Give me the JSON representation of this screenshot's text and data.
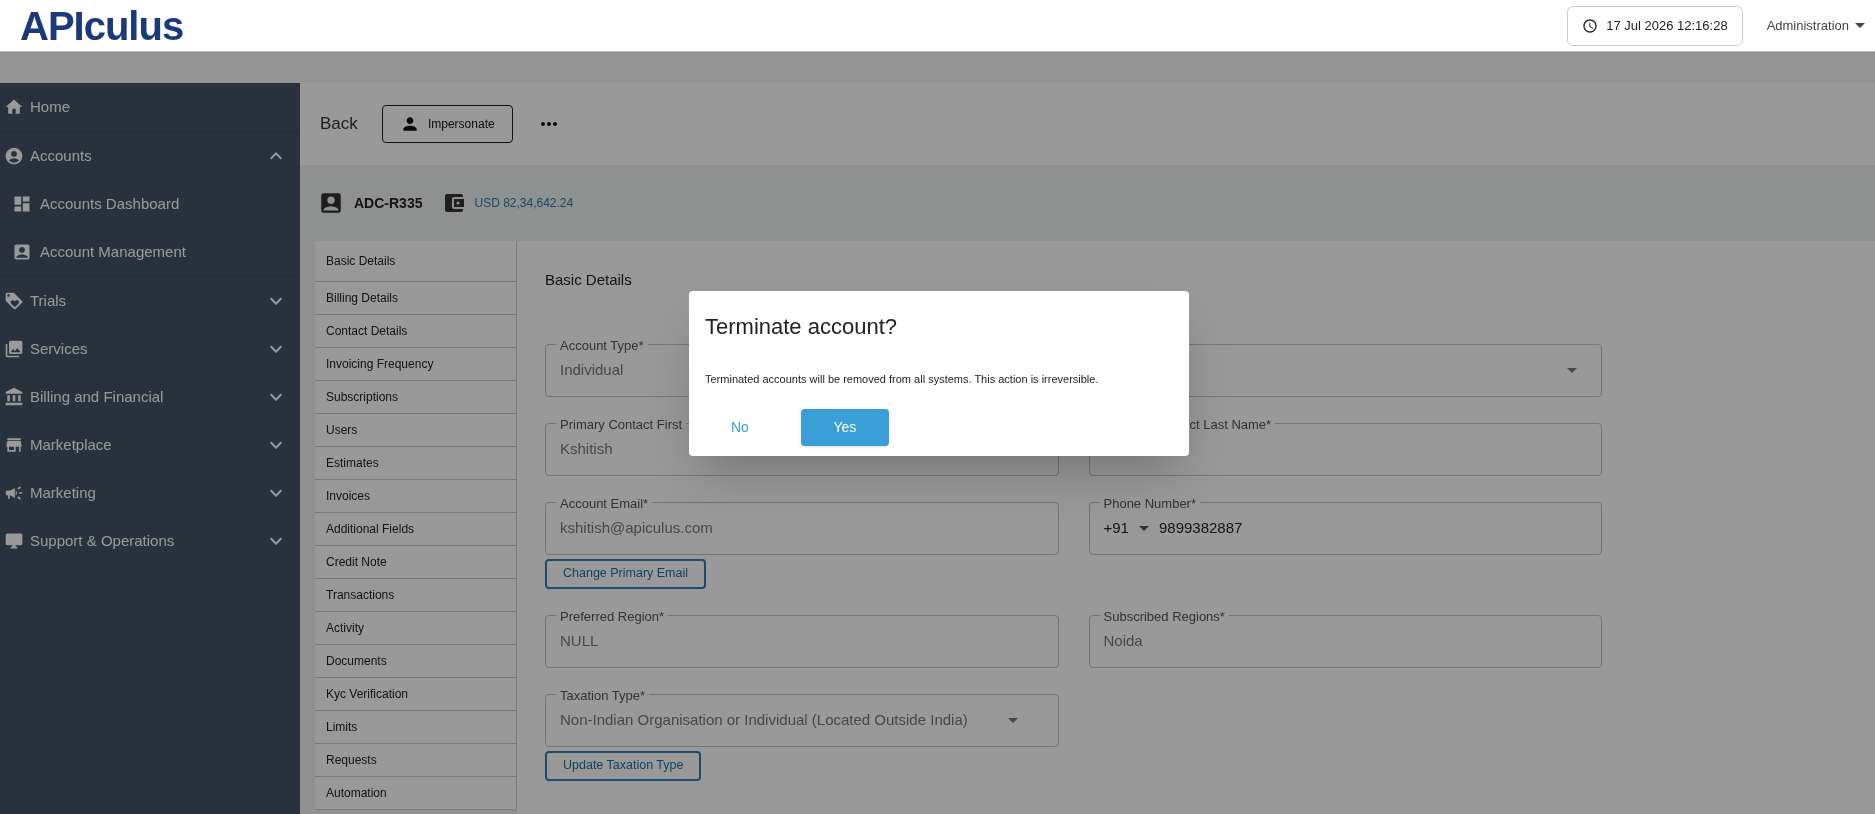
{
  "header": {
    "logo": "APIculus",
    "datetime": "17 Jul 2026 12:16:28",
    "user_menu": "Administration"
  },
  "sidebar": {
    "items": [
      {
        "label": "Home"
      },
      {
        "label": "Accounts",
        "expanded": true,
        "children": [
          {
            "label": "Accounts Dashboard"
          },
          {
            "label": "Account Management"
          }
        ]
      },
      {
        "label": "Trials",
        "expanded": false
      },
      {
        "label": "Services",
        "expanded": false
      },
      {
        "label": "Billing and Financial",
        "expanded": false
      },
      {
        "label": "Marketplace",
        "expanded": false
      },
      {
        "label": "Marketing",
        "expanded": false
      },
      {
        "label": "Support & Operations",
        "expanded": false
      }
    ]
  },
  "toolbar": {
    "back": "Back",
    "impersonate": "Impersonate"
  },
  "account": {
    "id": "ADC-R335",
    "balance": "USD 82,34,642.24"
  },
  "sections": [
    "Basic Details",
    "Billing Details",
    "Contact Details",
    "Invoicing Frequency",
    "Subscriptions",
    "Users",
    "Estimates",
    "Invoices",
    "Additional Fields",
    "Credit Note",
    "Transactions",
    "Activity",
    "Documents",
    "Kyc Verification",
    "Limits",
    "Requests",
    "Automation"
  ],
  "form": {
    "heading": "Basic Details",
    "rows": [
      [
        {
          "kind": "select",
          "label": "Account Type*",
          "value": "Individual"
        },
        {
          "kind": "select"
        }
      ],
      [
        {
          "kind": "text",
          "label": "Primary Contact First",
          "value": "Kshitish"
        },
        {
          "kind": "text",
          "label": "ct Last Name*"
        }
      ],
      [
        {
          "kind": "text",
          "label": "Account Email*",
          "value": "kshitish@apiculus.com",
          "action": "Change Primary Email"
        },
        {
          "kind": "phone",
          "label": "Phone Number*",
          "country_code": "+91",
          "value": "9899382887"
        }
      ],
      [
        {
          "kind": "text",
          "label": "Preferred Region*",
          "value": "NULL"
        },
        {
          "kind": "text",
          "label": "Subscribed Regions*",
          "value": "Noida"
        }
      ],
      [
        {
          "kind": "select",
          "label": "Taxation Type*",
          "value": "Non-Indian Organisation or Individual (Located Outside India)",
          "action": "Update Taxation Type"
        }
      ]
    ]
  },
  "dialog": {
    "title": "Terminate account?",
    "message": "Terminated accounts will be removed from all systems. This action is irreversible.",
    "buttons": [
      {
        "label": "No",
        "kind": "text"
      },
      {
        "label": "Yes",
        "kind": "primary"
      }
    ]
  }
}
